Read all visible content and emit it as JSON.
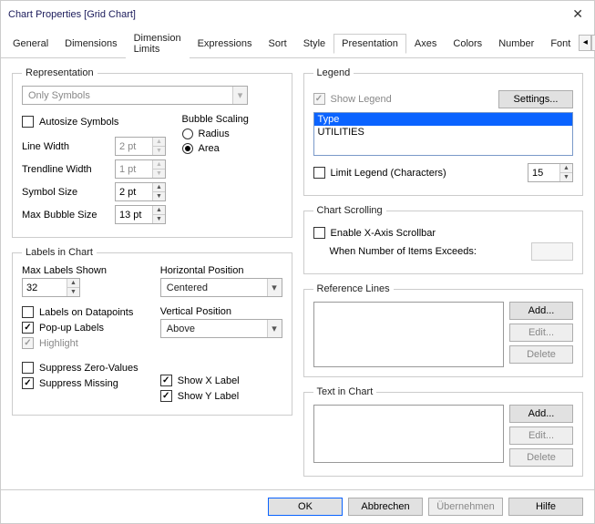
{
  "title": "Chart Properties [Grid Chart]",
  "tabs": [
    "General",
    "Dimensions",
    "Dimension Limits",
    "Expressions",
    "Sort",
    "Style",
    "Presentation",
    "Axes",
    "Colors",
    "Number",
    "Font"
  ],
  "activeTab": "Presentation",
  "rep": {
    "legend": "Representation",
    "comboVal": "Only Symbols",
    "autosize": "Autosize Symbols",
    "bubbleScaling": "Bubble Scaling",
    "radius": "Radius",
    "area": "Area",
    "lineWidth": {
      "label": "Line Width",
      "val": "2 pt"
    },
    "trendWidth": {
      "label": "Trendline Width",
      "val": "1 pt"
    },
    "symbolSize": {
      "label": "Symbol Size",
      "val": "2 pt"
    },
    "maxBubble": {
      "label": "Max Bubble Size",
      "val": "13 pt"
    }
  },
  "labels": {
    "legend": "Labels in Chart",
    "maxShown": {
      "label": "Max Labels Shown",
      "val": "32"
    },
    "hpos": {
      "label": "Horizontal Position",
      "val": "Centered"
    },
    "vpos": {
      "label": "Vertical Position",
      "val": "Above"
    },
    "onData": "Labels on Datapoints",
    "popup": "Pop-up Labels",
    "highlight": "Highlight",
    "suppressZero": "Suppress Zero-Values",
    "suppressMissing": "Suppress Missing",
    "showX": "Show X Label",
    "showY": "Show Y Label"
  },
  "legendBox": {
    "legend": "Legend",
    "show": "Show Legend",
    "settings": "Settings...",
    "items": [
      "Type",
      "UTILITIES"
    ],
    "limit": "Limit Legend (Characters)",
    "limitVal": "15"
  },
  "scroll": {
    "legend": "Chart Scrolling",
    "enable": "Enable X-Axis Scrollbar",
    "when": "When Number of Items Exceeds:"
  },
  "ref": {
    "legend": "Reference Lines",
    "add": "Add...",
    "edit": "Edit...",
    "del": "Delete"
  },
  "tic": {
    "legend": "Text in Chart",
    "add": "Add...",
    "edit": "Edit...",
    "del": "Delete"
  },
  "footer": {
    "ok": "OK",
    "cancel": "Abbrechen",
    "apply": "Übernehmen",
    "help": "Hilfe"
  }
}
